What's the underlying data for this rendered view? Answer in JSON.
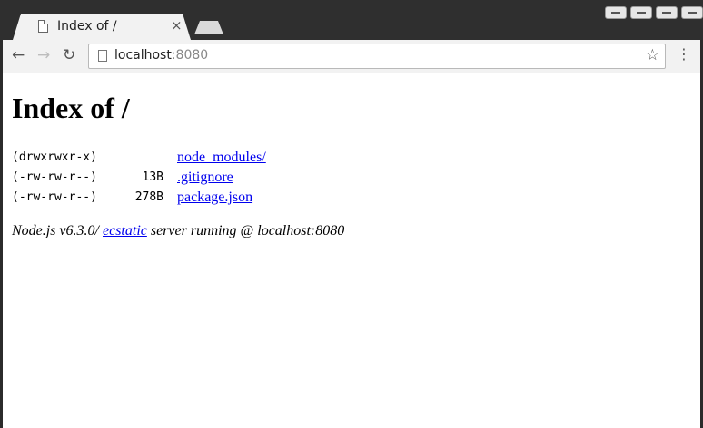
{
  "browser": {
    "tab_title": "Index of /",
    "tab_close": "×",
    "url_host": "localhost",
    "url_port": ":8080"
  },
  "page": {
    "heading": "Index of /",
    "entries": [
      {
        "perm": "(drwxrwxr-x)",
        "size": "",
        "name": "node_modules/"
      },
      {
        "perm": "(-rw-rw-r--)",
        "size": "13B",
        "name": ".gitignore"
      },
      {
        "perm": "(-rw-rw-r--)",
        "size": "278B",
        "name": "package.json"
      }
    ],
    "footer_prefix": "Node.js v6.3.0/ ",
    "footer_link": "ecstatic",
    "footer_suffix": " server running @ localhost:8080"
  },
  "icons": {
    "back": "←",
    "forward": "→",
    "reload": "↻",
    "star": "☆",
    "menu": "⋮"
  }
}
